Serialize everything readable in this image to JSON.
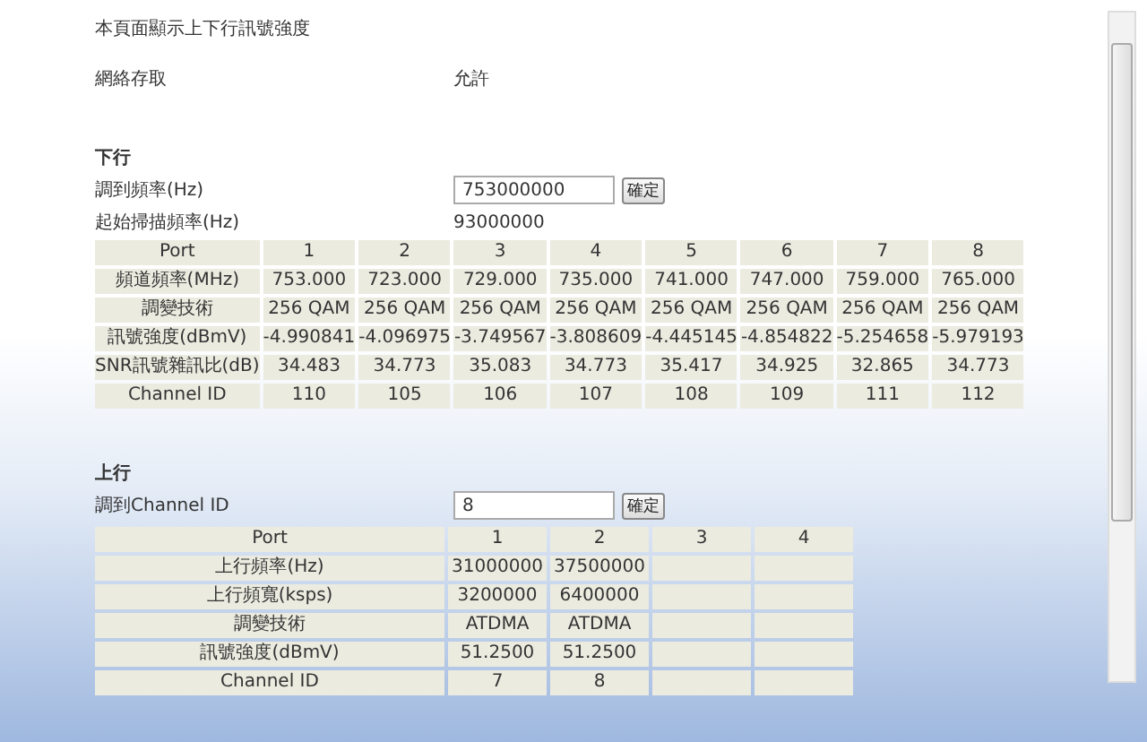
{
  "intro": "本頁面顯示上下行訊號強度",
  "access": {
    "label": "網絡存取",
    "value": "允許"
  },
  "downstream": {
    "title": "下行",
    "tune": {
      "label": "調到頻率(Hz)",
      "value": "753000000",
      "button": "確定"
    },
    "start": {
      "label": "起始掃描頻率(Hz)",
      "value": "93000000"
    },
    "rows": [
      [
        "Port",
        "1",
        "2",
        "3",
        "4",
        "5",
        "6",
        "7",
        "8"
      ],
      [
        "頻道頻率(MHz)",
        "753.000",
        "723.000",
        "729.000",
        "735.000",
        "741.000",
        "747.000",
        "759.000",
        "765.000"
      ],
      [
        "調變技術",
        "256 QAM",
        "256 QAM",
        "256 QAM",
        "256 QAM",
        "256 QAM",
        "256 QAM",
        "256 QAM",
        "256 QAM"
      ],
      [
        "訊號強度(dBmV)",
        "-4.990841",
        "-4.096975",
        "-3.749567",
        "-3.808609",
        "-4.445145",
        "-4.854822",
        "-5.254658",
        "-5.979193"
      ],
      [
        "SNR訊號雜訊比(dB)",
        "34.483",
        "34.773",
        "35.083",
        "34.773",
        "35.417",
        "34.925",
        "32.865",
        "34.773"
      ],
      [
        "Channel ID",
        "110",
        "105",
        "106",
        "107",
        "108",
        "109",
        "111",
        "112"
      ]
    ]
  },
  "upstream": {
    "title": "上行",
    "tune": {
      "label": "調到Channel ID",
      "value": "8",
      "button": "確定"
    },
    "rows": [
      [
        "Port",
        "1",
        "2",
        "3",
        "4"
      ],
      [
        "上行頻率(Hz)",
        "31000000",
        "37500000",
        "",
        ""
      ],
      [
        "上行頻寬(ksps)",
        "3200000",
        "6400000",
        "",
        ""
      ],
      [
        "調變技術",
        "ATDMA",
        "ATDMA",
        "",
        ""
      ],
      [
        "訊號強度(dBmV)",
        "51.2500",
        "51.2500",
        "",
        ""
      ],
      [
        "Channel ID",
        "7",
        "8",
        "",
        ""
      ]
    ]
  }
}
